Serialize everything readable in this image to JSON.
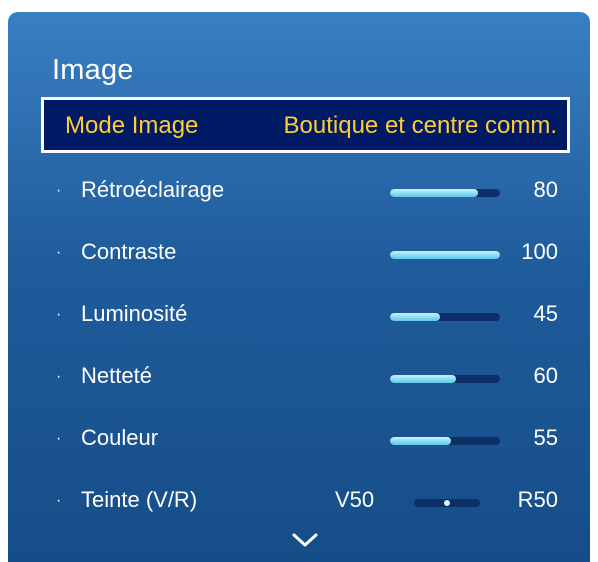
{
  "panel": {
    "title": "Image"
  },
  "selected": {
    "label": "Mode Image",
    "value": "Boutique et centre comm."
  },
  "items": [
    {
      "label": "Rétroéclairage",
      "value": "80",
      "level": 0.8
    },
    {
      "label": "Contraste",
      "value": "100",
      "level": 1.0
    },
    {
      "label": "Luminosité",
      "value": "45",
      "level": 0.45
    },
    {
      "label": "Netteté",
      "value": "60",
      "level": 0.6
    },
    {
      "label": "Couleur",
      "value": "55",
      "level": 0.55
    }
  ],
  "tint": {
    "label": "Teinte (V/R)",
    "left": "V50",
    "right": "R50",
    "level": 0.5
  },
  "icons": {
    "scroll_down": "chevron-down-icon"
  },
  "colors": {
    "panel_top": "#3a7fc2",
    "panel_bottom": "#164d88",
    "highlight_text": "#ffcc33",
    "selected_bg": "#001a66"
  }
}
